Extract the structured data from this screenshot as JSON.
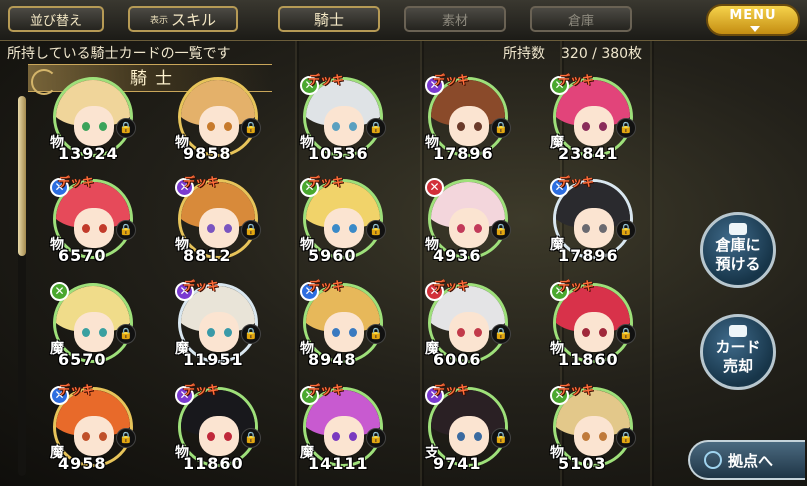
{
  "topbar": {
    "sort_label": "並び替え",
    "display_prefix": "表示",
    "display_value": "スキル",
    "tabs": [
      {
        "label": "騎士",
        "active": true
      },
      {
        "label": "素材",
        "active": false
      },
      {
        "label": "倉庫",
        "active": false
      }
    ],
    "menu_label": "MENU"
  },
  "header": {
    "description": "所持している騎士カードの一覧です",
    "count_label": "所持数",
    "count_value": "320 / 380枚"
  },
  "section": {
    "title": "騎士"
  },
  "cards": [
    {
      "deck": "",
      "badge": "",
      "type": "物",
      "power": "13924",
      "hair": "#f0d59a",
      "eye": "#3ba35a",
      "ring": "#9ee07a"
    },
    {
      "deck": "",
      "badge": "",
      "type": "物",
      "power": "9858",
      "hair": "#e4b16a",
      "eye": "#c77a2c",
      "ring": "#e7c45a"
    },
    {
      "deck": "デッキ",
      "badge": "g",
      "type": "物",
      "power": "10536",
      "hair": "#dfe3e6",
      "eye": "#5aa0c0",
      "ring": "#9ee07a"
    },
    {
      "deck": "デッキ",
      "badge": "p",
      "type": "物",
      "power": "17896",
      "hair": "#8a4a2a",
      "eye": "#6a3a2a",
      "ring": "#9ee07a"
    },
    {
      "deck": "デッキ",
      "badge": "g",
      "type": "魔",
      "power": "23841",
      "hair": "#e2447a",
      "eye": "#8a2c5a",
      "ring": "#9ee07a"
    },
    {
      "deck": "デッキ",
      "badge": "b",
      "type": "物",
      "power": "6570",
      "hair": "#e64a5a",
      "eye": "#c23a2a",
      "ring": "#9ee07a"
    },
    {
      "deck": "デッキ",
      "badge": "p",
      "type": "物",
      "power": "8812",
      "hair": "#d88a3a",
      "eye": "#7a55c0",
      "ring": "#e7c45a"
    },
    {
      "deck": "デッキ",
      "badge": "g",
      "type": "物",
      "power": "5960",
      "hair": "#f1d36a",
      "eye": "#3a8ac8",
      "ring": "#9ee07a"
    },
    {
      "deck": "",
      "badge": "r",
      "type": "物",
      "power": "4936",
      "hair": "#f3d6dc",
      "eye": "#c23a5a",
      "ring": "#9ee07a"
    },
    {
      "deck": "デッキ",
      "badge": "b",
      "type": "魔",
      "power": "17896",
      "hair": "#2a2a2e",
      "eye": "#6a6a70",
      "ring": "#d9e7f0"
    },
    {
      "deck": "",
      "badge": "g",
      "type": "魔",
      "power": "6570",
      "hair": "#f0dc8a",
      "eye": "#3aa0a0",
      "ring": "#9ee07a"
    },
    {
      "deck": "デッキ",
      "badge": "p",
      "type": "魔",
      "power": "11951",
      "hair": "#e9e4d8",
      "eye": "#3a9aa8",
      "ring": "#d9e7f0"
    },
    {
      "deck": "デッキ",
      "badge": "b",
      "type": "物",
      "power": "8948",
      "hair": "#e7b85a",
      "eye": "#3a7ac0",
      "ring": "#9ee07a"
    },
    {
      "deck": "デッキ",
      "badge": "r",
      "type": "魔",
      "power": "6006",
      "hair": "#e4e4e6",
      "eye": "#c23a4a",
      "ring": "#9ee07a"
    },
    {
      "deck": "デッキ",
      "badge": "g",
      "type": "物",
      "power": "11860",
      "hair": "#d8324a",
      "eye": "#a0283a",
      "ring": "#9ee07a"
    },
    {
      "deck": "デッキ",
      "badge": "b",
      "type": "魔",
      "power": "4958",
      "hair": "#e86a2a",
      "eye": "#c0502a",
      "ring": "#e7c45a"
    },
    {
      "deck": "デッキ",
      "badge": "p",
      "type": "物",
      "power": "11860",
      "hair": "#18181c",
      "eye": "#c0283a",
      "ring": "#9ee07a"
    },
    {
      "deck": "デッキ",
      "badge": "g",
      "type": "魔",
      "power": "14111",
      "hair": "#c85ad0",
      "eye": "#7a3ac0",
      "ring": "#9ee07a"
    },
    {
      "deck": "デッキ",
      "badge": "p",
      "type": "支",
      "power": "9741",
      "hair": "#2a2024",
      "eye": "#3a6aa0",
      "ring": "#9ee07a"
    },
    {
      "deck": "デッキ",
      "badge": "g",
      "type": "物",
      "power": "5103",
      "hair": "#e3c88a",
      "eye": "#c07a3a",
      "ring": "#9ee07a"
    }
  ],
  "side_buttons": {
    "store_line1": "倉庫に",
    "store_line2": "預ける",
    "sell_line1": "カード",
    "sell_line2": "売却",
    "base_label": "拠点へ"
  }
}
